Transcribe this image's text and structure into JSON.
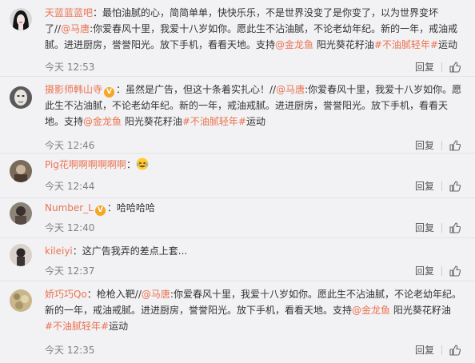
{
  "colors": {
    "link": "#eb7350",
    "meta": "#808080",
    "background": "#f2f2f5"
  },
  "actions": {
    "reply_label": "回复",
    "like_icon": "thumbs-up-icon"
  },
  "comments": [
    {
      "user": "天蓝蓝蓝吧",
      "verified": false,
      "lines": [
        [
          {
            "t": "：最怕油腻的心，简简单单，快快乐乐，不是世界没变了是你变了，以为世界变坏"
          }
        ],
        [
          {
            "t": "了//"
          },
          {
            "t": "@马唐",
            "link": true
          },
          {
            "t": ":你爱春风十里，我爱十八岁如你。愿此生不沾油腻，不论老幼年纪。新的一年，戒油戒"
          }
        ],
        [
          {
            "t": "腻。进进厨房，誉誉阳光。放下手机，看看天地。支持"
          },
          {
            "t": "@金龙鱼",
            "link": true
          },
          {
            "t": " 阳光葵花籽油"
          },
          {
            "t": "#不油腻轻年#",
            "link": true
          },
          {
            "t": "运动"
          }
        ]
      ],
      "time": "今天 12:53"
    },
    {
      "user": "摄影师韩山寺",
      "verified": true,
      "lines": [
        [
          {
            "t": "：虽然是广告，但这十条着实扎心！//"
          },
          {
            "t": "@马唐",
            "link": true
          },
          {
            "t": ":你爱春风十里，我爱十八岁如你。愿"
          }
        ],
        [
          {
            "t": "此生不沾油腻，不论老幼年纪。新的一年，戒油戒腻。进进厨房，誉誉阳光。放下手机，看看天"
          }
        ],
        [
          {
            "t": "地。支持"
          },
          {
            "t": "@金龙鱼",
            "link": true
          },
          {
            "t": " 阳光葵花籽油"
          },
          {
            "t": "#不油腻轻年#",
            "link": true
          },
          {
            "t": "运动"
          }
        ]
      ],
      "time": "今天 12:46"
    },
    {
      "user": "Pig花啊啊啊啊啊啊",
      "verified": false,
      "lines": [
        [
          {
            "t": "："
          },
          {
            "emoji": "laugh-cry-emoji"
          }
        ]
      ],
      "time": "今天 12:44"
    },
    {
      "user": "Number_L",
      "verified": true,
      "lines": [
        [
          {
            "t": "：哈哈哈哈"
          }
        ]
      ],
      "time": "今天 12:40"
    },
    {
      "user": "kileiyi",
      "verified": false,
      "lines": [
        [
          {
            "t": "：这广告我弄的差点上套..."
          }
        ]
      ],
      "time": "今天 12:37"
    },
    {
      "user": "娇巧巧Qo",
      "verified": false,
      "lines": [
        [
          {
            "t": "：枪枪入靶//"
          },
          {
            "t": "@马唐",
            "link": true
          },
          {
            "t": ":你爱春风十里，我爱十八岁如你。愿此生不沾油腻，不论老幼年纪。"
          }
        ],
        [
          {
            "t": "新的一年，戒油戒腻。进进厨房，誉誉阳光。放下手机，看看天地。支持"
          },
          {
            "t": "@金龙鱼",
            "link": true
          },
          {
            "t": " 阳光葵花籽油"
          }
        ],
        [
          {
            "t": "#不油腻轻年#",
            "link": true
          },
          {
            "t": "运动"
          }
        ]
      ],
      "time": "今天 12:35"
    }
  ]
}
